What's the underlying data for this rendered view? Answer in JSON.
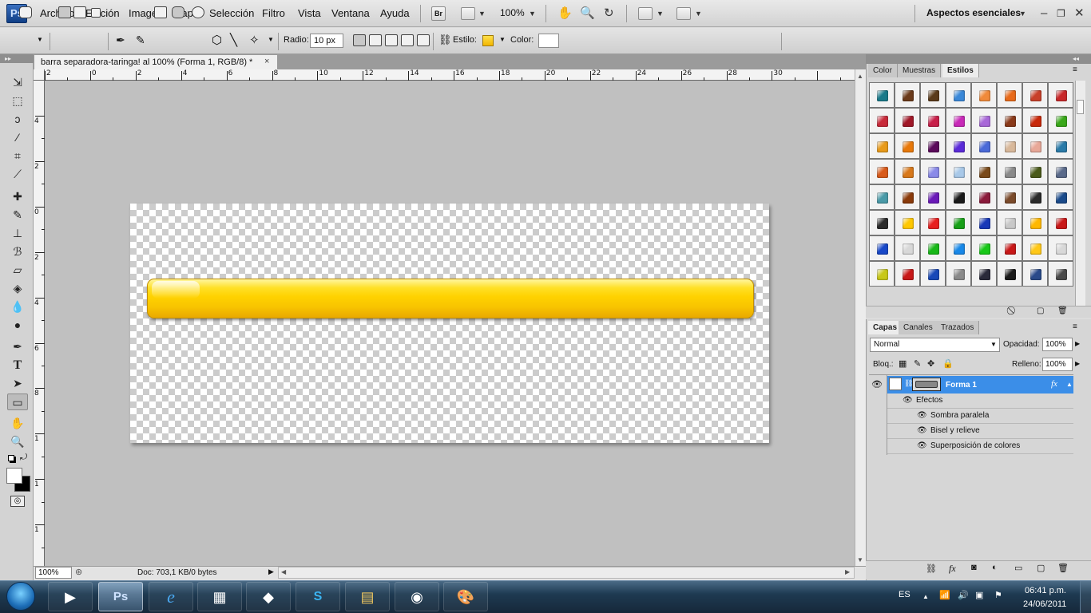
{
  "app": {
    "logo": "Ps"
  },
  "menu": {
    "items": [
      "Archivo",
      "Edición",
      "Imagen",
      "Capa",
      "Selección",
      "Filtro",
      "Vista",
      "Ventana",
      "Ayuda"
    ],
    "bridge": "Br",
    "zoom": "100%",
    "workspace": "Aspectos esenciales"
  },
  "options": {
    "radius_label": "Radio:",
    "radius_value": "10 px",
    "style_label": "Estilo:",
    "color_label": "Color:"
  },
  "document": {
    "tab_title": "barra separadora-taringa! al 100% (Forma 1, RGB/8) *",
    "close": "×",
    "zoom": "100%",
    "info": "Doc: 703,1 KB/0 bytes"
  },
  "rulers": {
    "h": [
      "2",
      "0",
      "2",
      "4",
      "6",
      "8",
      "10",
      "12",
      "14",
      "16",
      "18",
      "20",
      "22",
      "24",
      "26",
      "28",
      "30"
    ],
    "v": [
      "4",
      "2",
      "0",
      "2",
      "4",
      "6",
      "8",
      "1",
      "1",
      "1"
    ]
  },
  "panels": {
    "top_tabs": [
      "Color",
      "Muestras",
      "Estilos"
    ],
    "layer_tabs": [
      "Capas",
      "Canales",
      "Trazados"
    ],
    "blend_mode": "Normal",
    "opacity_label": "Opacidad:",
    "opacity": "100%",
    "lock_label": "Bloq.:",
    "fill_label": "Relleno:",
    "fill": "100%",
    "layer_name": "Forma 1",
    "fx": "fx",
    "effects_label": "Efectos",
    "effects": [
      "Sombra paralela",
      "Bisel y relieve",
      "Superposición de colores"
    ]
  },
  "style_colors": [
    "#1a7a8a",
    "#6b3a1a",
    "#5a3a1a",
    "#3a88d8",
    "#f08a3a",
    "#e86a1a",
    "#c8402a",
    "#c8282a",
    "#c82a3a",
    "#a01828",
    "#c8204a",
    "#c82ab8",
    "#a868d8",
    "#8a3a1a",
    "#c8280a",
    "#3aa81a",
    "#e89a1a",
    "#e8780a",
    "#5a0a5a",
    "#5a2ad8",
    "#4a6ad8",
    "#d8b89a",
    "#e8a898",
    "#2a7aa8",
    "#d85a1a",
    "#d8781a",
    "#8a8ae8",
    "#a8c8e8",
    "#7a4a1a",
    "#8a8a8a",
    "#4a5a1a",
    "#5a6a8a",
    "#4a9aa8",
    "#8a3a0a",
    "#6a1ab8",
    "#1a1a1a",
    "#8a1a3a",
    "#7a4a2a",
    "#2a2a2a",
    "#1a4a8a",
    "#2a2a2a",
    "#ffc800",
    "#e82020",
    "#18a018",
    "#1838b8",
    "#c8c8c8",
    "#ffb800",
    "#c81818",
    "#1848c8",
    "#d8d8d8",
    "#18b818",
    "#1888e8",
    "#18c818",
    "#c81818",
    "#ffc818",
    "#d8d8d8",
    "#c8c818",
    "#c81818",
    "#1848b8",
    "#8a8a8a",
    "#2a2a3a",
    "#1a1a1a",
    "#2a4a8a",
    "#4a4a4a"
  ],
  "taskbar": {
    "lang": "ES",
    "time": "06:41 p.m.",
    "date": "24/06/2011"
  }
}
